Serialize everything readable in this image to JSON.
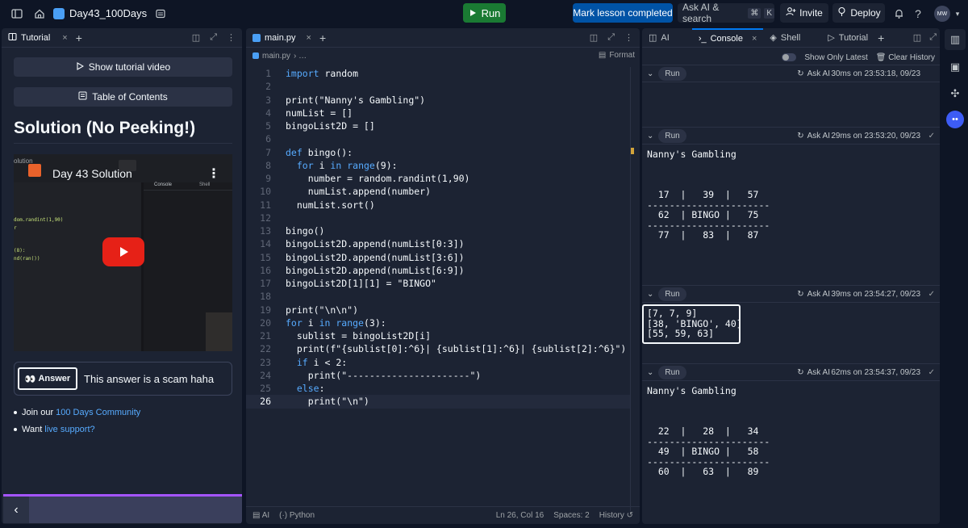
{
  "topbar": {
    "repl_name": "Day43_100Days",
    "run_label": "Run",
    "mark_complete_label": "Mark lesson completed",
    "ask_ai_label": "Ask AI & search",
    "shortcut_cmd": "⌘",
    "shortcut_key": "K",
    "invite_label": "Invite",
    "deploy_label": "Deploy",
    "avatar_initials": "MW"
  },
  "left_pane": {
    "tab_label": "Tutorial",
    "show_video_label": "Show tutorial video",
    "toc_label": "Table of Contents",
    "solution_title": "Solution (No Peeking!)",
    "video": {
      "title": "Day 43 Solution",
      "overlay_console_tab": "Console",
      "overlay_shell_tab": "Shell",
      "code_snippets": [
        "dom.randint(1,90)",
        "r",
        "(8):",
        "nd(ran())"
      ],
      "overlay_label": "olution"
    },
    "answer_button_label": "Answer",
    "answer_text": "This answer is a scam haha",
    "bullets": [
      {
        "prefix": "Join our ",
        "link": "100 Days Community"
      },
      {
        "prefix": "Want ",
        "link": "live support?"
      }
    ]
  },
  "editor": {
    "tab_label": "main.py",
    "breadcrumb_file": "main.py",
    "breadcrumb_sep": "› …",
    "format_label": "Format",
    "code_lines": [
      "import random",
      "",
      "print(\"Nanny's Gambling\")",
      "numList = []",
      "bingoList2D = []",
      "",
      "def bingo():",
      "  for i in range(9):",
      "    number = random.randint(1,90)",
      "    numList.append(number)",
      "  numList.sort()",
      "",
      "bingo()",
      "bingoList2D.append(numList[0:3])",
      "bingoList2D.append(numList[3:6])",
      "bingoList2D.append(numList[6:9])",
      "bingoList2D[1][1] = \"BINGO\"",
      "",
      "print(\"\\n\\n\")",
      "for i in range(3):",
      "  sublist = bingoList2D[i]",
      "  print(f\"{sublist[0]:^6}| {sublist[1]:^6}| {sublist[2]:^6}\")",
      "  if i < 2:",
      "    print(\"----------------------\")",
      "  else:",
      "    print(\"\\n\")"
    ],
    "current_line": 26,
    "status": {
      "ai": "AI",
      "language": "Python",
      "position": "Ln 26, Col 16",
      "spaces": "Spaces: 2",
      "history": "History"
    }
  },
  "console": {
    "tabs": [
      {
        "label": "AI"
      },
      {
        "label": "Console"
      },
      {
        "label": "Shell"
      },
      {
        "label": "Tutorial"
      }
    ],
    "show_only_latest_label": "Show Only Latest",
    "clear_history_label": "Clear History",
    "entries": [
      {
        "run_label": "Run",
        "ask_ai": "Ask AI",
        "time": "30ms on 23:53:18, 09/23",
        "output": ""
      },
      {
        "run_label": "Run",
        "ask_ai": "Ask AI",
        "time": "29ms on 23:53:20, 09/23",
        "output": "Nanny's Gambling\n\n\n\n  17  |   39  |   57  \n----------------------\n  62  | BINGO |   75  \n----------------------\n  77  |   83  |   87  "
      },
      {
        "run_label": "Run",
        "ask_ai": "Ask AI",
        "time": "39ms on 23:54:27, 09/23",
        "output": "[7, 7, 9]\n[38, 'BINGO', 40]\n[55, 59, 63]"
      },
      {
        "run_label": "Run",
        "ask_ai": "Ask AI",
        "time": "62ms on 23:54:37, 09/23",
        "output": "Nanny's Gambling\n\n\n\n  22  |   28  |   34  \n----------------------\n  49  | BINGO |   58  \n----------------------\n  60  |   63  |   89  "
      }
    ]
  },
  "colors": {
    "accent_blue": "#0053a6",
    "run_green": "#1a7a33",
    "progress_purple": "#a454ff",
    "youtube_red": "#e62117"
  }
}
